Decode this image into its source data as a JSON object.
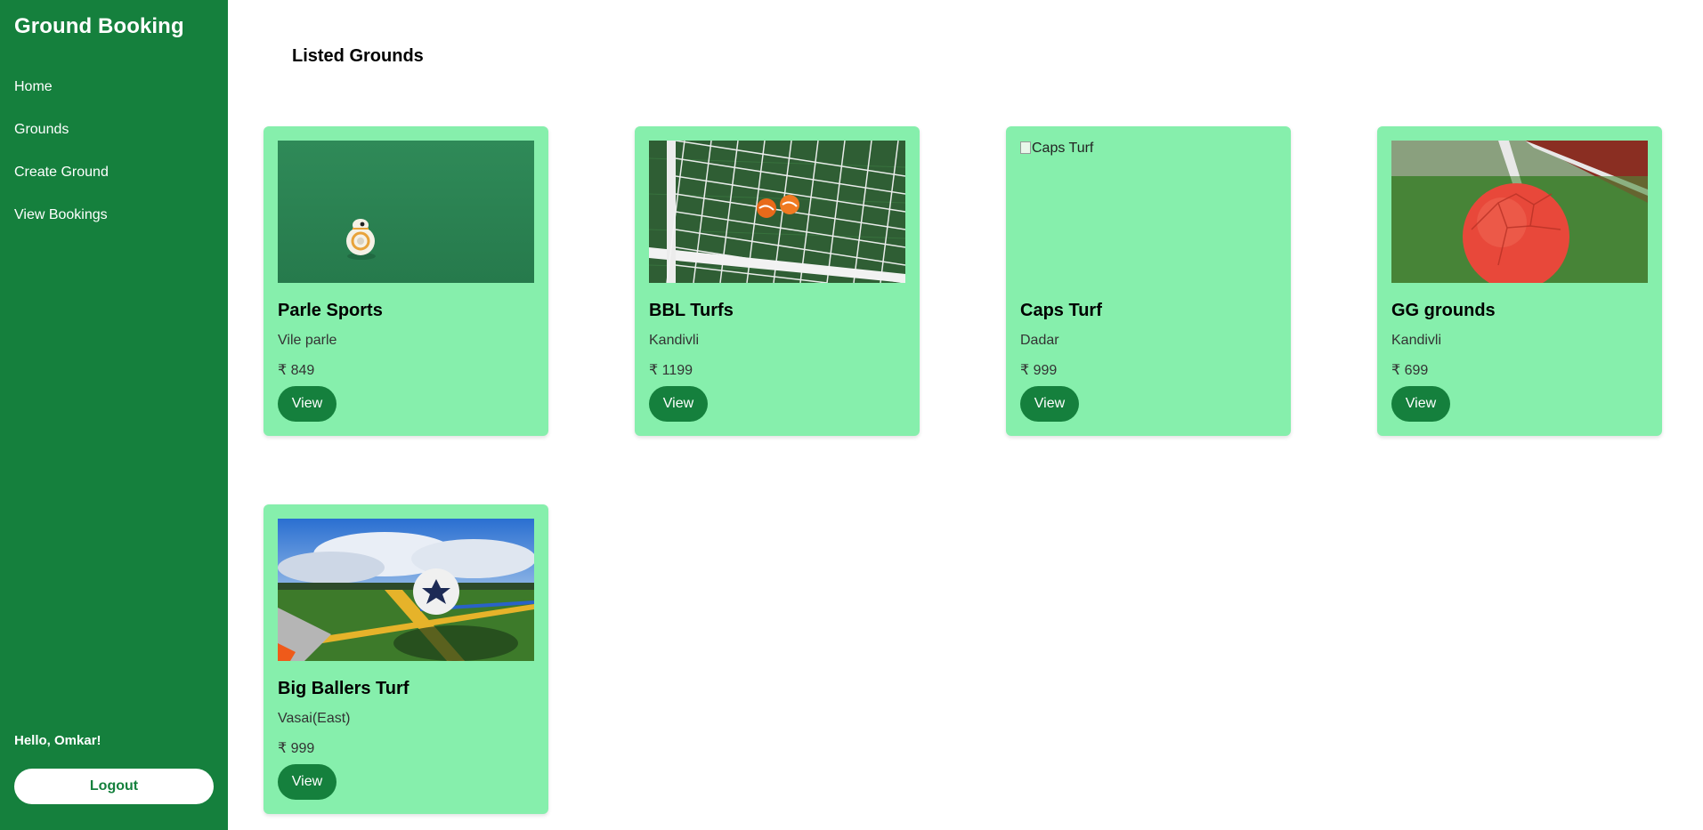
{
  "app": {
    "title": "Ground Booking"
  },
  "sidebar": {
    "items": [
      {
        "label": "Home"
      },
      {
        "label": "Grounds"
      },
      {
        "label": "Create Ground"
      },
      {
        "label": "View Bookings"
      }
    ],
    "greeting": "Hello, Omkar!",
    "logout_label": "Logout"
  },
  "main": {
    "title": "Listed Grounds",
    "grounds": [
      {
        "name": "Parle Sports",
        "location": "Vile parle",
        "price": "₹ 849",
        "view_label": "View",
        "image": "turf-robot-image"
      },
      {
        "name": "BBL Turfs",
        "location": "Kandivli",
        "price": "₹ 1199",
        "view_label": "View",
        "image": "goal-net-image"
      },
      {
        "name": "Caps Turf",
        "location": "Dadar",
        "price": "₹ 999",
        "view_label": "View",
        "image_alt": "Caps Turf"
      },
      {
        "name": "GG grounds",
        "location": "Kandivli",
        "price": "₹ 699",
        "view_label": "View",
        "image": "red-ball-image"
      },
      {
        "name": "Big Ballers Turf",
        "location": "Vasai(East)",
        "price": "₹ 999",
        "view_label": "View",
        "image": "football-field-sky-image"
      }
    ]
  },
  "colors": {
    "sidebar": "#15803d",
    "card": "#86efac",
    "button": "#15803d"
  }
}
